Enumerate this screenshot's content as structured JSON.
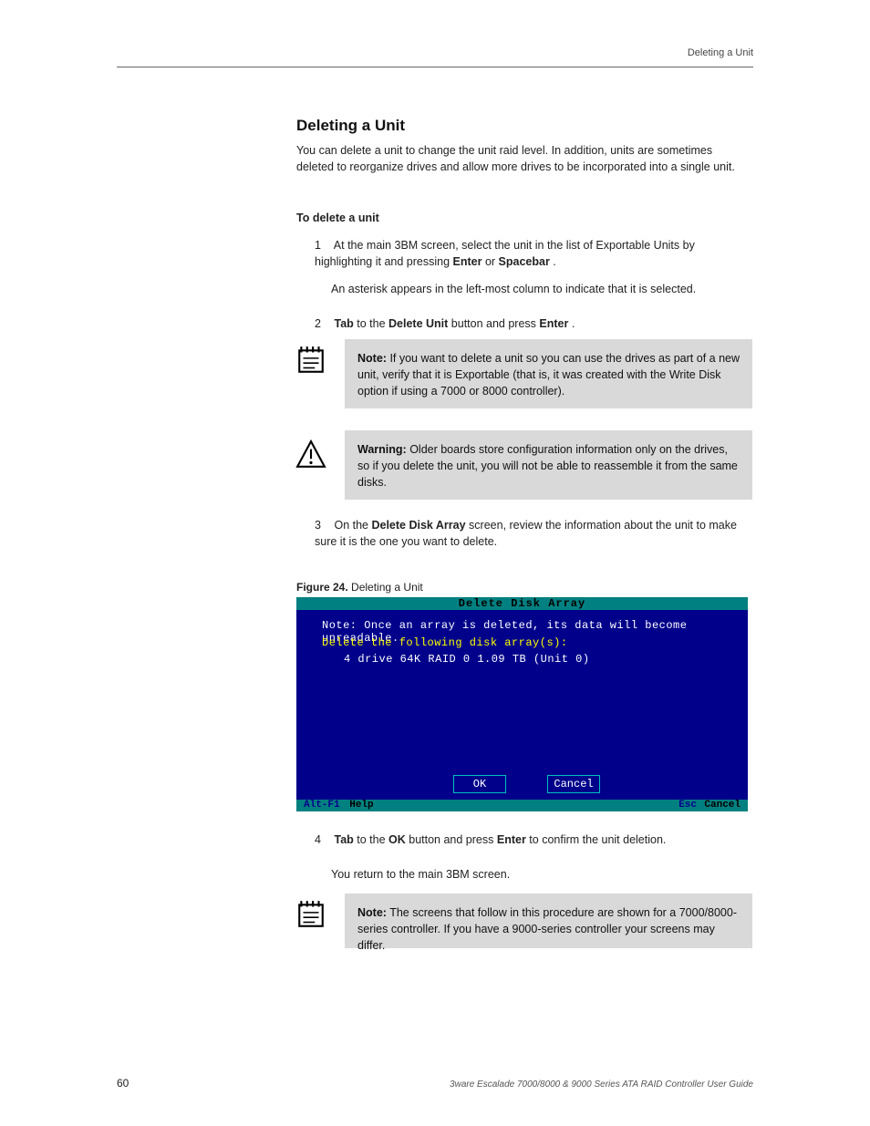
{
  "header": {
    "right_text": "Deleting a Unit"
  },
  "section": {
    "title": "Deleting a Unit",
    "intro": "You can delete a unit to change the unit raid level. In addition, units are sometimes deleted to reorganize drives and allow more drives to be incorporated into a single unit.",
    "to_delete_heading": "To delete a unit",
    "steps": {
      "s1_pre": "At the main 3BM screen, select the unit in the list of Exportable Units by highlighting it and pressing ",
      "s1_key1": "Enter",
      "s1_mid": " or ",
      "s1_key2": "Spacebar",
      "s1_post": ".",
      "s1_after": "An asterisk appears in the left-most column to indicate that it is selected.",
      "s2_pre": "",
      "s2_key1": "Tab",
      "s2_mid1": " to the ",
      "s2_btn": "Delete Unit",
      "s2_mid2": " button and press ",
      "s2_key2": "Enter",
      "s2_post": ".",
      "s3_pre": "On the ",
      "s3_win": "Delete Disk Array",
      "s3_mid": " screen, review the information about the unit to make sure it is the one you want to delete.",
      "s4_pre": "",
      "s4_key1": "Tab",
      "s4_mid1": " to the ",
      "s4_btn": "OK",
      "s4_mid2": " button and press ",
      "s4_key2": "Enter",
      "s4_mid3": " to confirm the unit deletion.",
      "s4_after": "You return to the main 3BM screen."
    }
  },
  "callouts": {
    "note1_label": "Note:",
    "note1_text": " If you want to delete a unit so you can use the drives as part of a new unit, verify that it is Exportable (that is, it was created with the Write Disk option if using a 7000 or 8000 controller).",
    "warn_label": "Warning:",
    "warn_text": " Older boards store configuration information only on the drives, so if you delete the unit, you will not be able to reassemble it from the same disks.",
    "note2_label": "Note:",
    "note2_text": " The screens that follow in this procedure are shown for a 7000/8000-series controller. If you have a 9000-series controller your screens may differ."
  },
  "figure": {
    "caption_label": "Figure 24.",
    "caption_text": " Deleting a Unit"
  },
  "bios": {
    "title": "Delete Disk Array",
    "note": "Note: Once an array is deleted, its data will become unreadable.",
    "prompt": "Delete the following disk array(s):",
    "entry": "4 drive 64K  RAID 0   1.09 TB (Unit 0)",
    "ok": "OK",
    "cancel": "Cancel",
    "footer_key": "Alt-F1",
    "footer_help": "Help",
    "footer_esc": "Esc",
    "footer_cancel": "Cancel"
  },
  "footer": {
    "page": "60",
    "copyright": "3ware Escalade 7000/8000 & 9000 Series ATA RAID Controller User Guide"
  }
}
